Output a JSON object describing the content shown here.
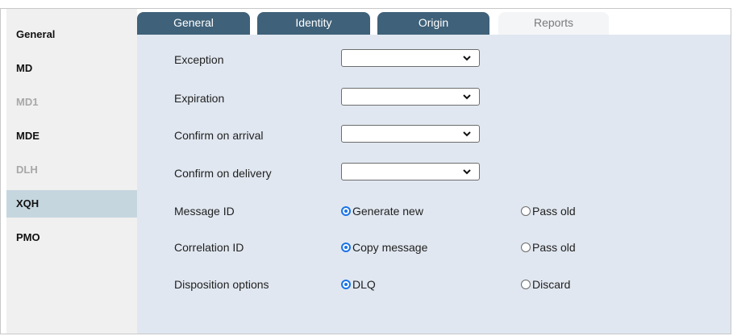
{
  "sidebar": {
    "items": [
      {
        "label": "General",
        "state": "normal"
      },
      {
        "label": "MD",
        "state": "normal"
      },
      {
        "label": "MD1",
        "state": "disabled"
      },
      {
        "label": "MDE",
        "state": "normal"
      },
      {
        "label": "DLH",
        "state": "disabled"
      },
      {
        "label": "XQH",
        "state": "selected"
      },
      {
        "label": "PMO",
        "state": "normal"
      }
    ]
  },
  "tabs": [
    {
      "label": "General",
      "active": false
    },
    {
      "label": "Identity",
      "active": false
    },
    {
      "label": "Origin",
      "active": false
    },
    {
      "label": "Reports",
      "active": true
    }
  ],
  "form": {
    "selects": [
      {
        "label": "Exception",
        "value": ""
      },
      {
        "label": "Expiration",
        "value": ""
      },
      {
        "label": "Confirm on arrival",
        "value": ""
      },
      {
        "label": "Confirm on delivery",
        "value": ""
      }
    ],
    "radios": [
      {
        "label": "Message ID",
        "option1": "Generate new",
        "option2": "Pass old",
        "selected": "option1"
      },
      {
        "label": "Correlation ID",
        "option1": "Copy message",
        "option2": "Pass old",
        "selected": "option1"
      },
      {
        "label": "Disposition options",
        "option1": "DLQ",
        "option2": "Discard",
        "selected": "option1"
      }
    ]
  },
  "colors": {
    "tab_bg": "#3f6179",
    "panel_bg": "#e0e7f0",
    "sidebar_selected": "#c5d6df",
    "radio_accent": "#1a73e8"
  },
  "icons": {
    "select_arrow": "chevron-down-icon"
  }
}
